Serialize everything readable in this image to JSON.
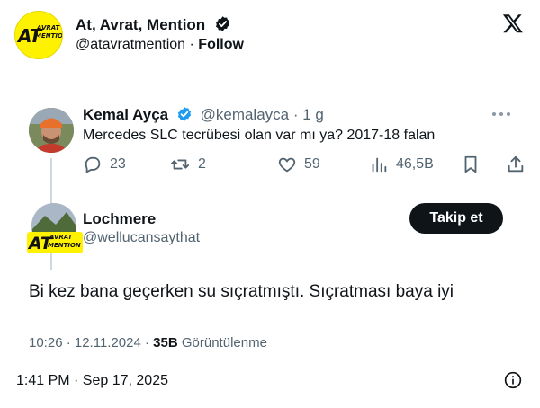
{
  "embed": {
    "account_name": "At, Avrat, Mention",
    "handle": "@atavratmention",
    "separator": " · ",
    "follow_label": "Follow",
    "logo_text_main": "AT",
    "logo_text_top": "AVRAT",
    "logo_text_bottom": "MENTION"
  },
  "tweet": {
    "author_name": "Kemal Ayça",
    "author_handle": "@kemalayca · 1 g",
    "text": "Mercedes SLC tecrübesi olan var mı ya? 2017-18 falan",
    "replies": "23",
    "retweets": "2",
    "likes": "59",
    "views": "46,5B"
  },
  "reply": {
    "author_name": "Lochmere",
    "author_handle": "@wellucansaythat",
    "follow_button": "Takip et",
    "text": "Bi kez bana geçerken su sıçratmıştı. Sıçratması baya iyi",
    "timestamp": "10:26 · 12.11.2024 · ",
    "view_count": "35B",
    "view_label": " Görüntülenme",
    "avatar_text_main": "AT",
    "avatar_text_top": "AVRAT",
    "avatar_text_bottom": "MENTION"
  },
  "footer": {
    "posted_at": "1:41 PM · Sep 17, 2025"
  },
  "colors": {
    "text": "#0f1419",
    "secondary": "#536471",
    "verified_blue": "#1d9bf0",
    "logo_yellow": "#fff200"
  },
  "icons": [
    "verified-badge-icon",
    "x-logo-icon",
    "more-icon",
    "reply-icon",
    "retweet-icon",
    "like-icon",
    "views-icon",
    "bookmark-icon",
    "share-icon",
    "info-icon"
  ]
}
